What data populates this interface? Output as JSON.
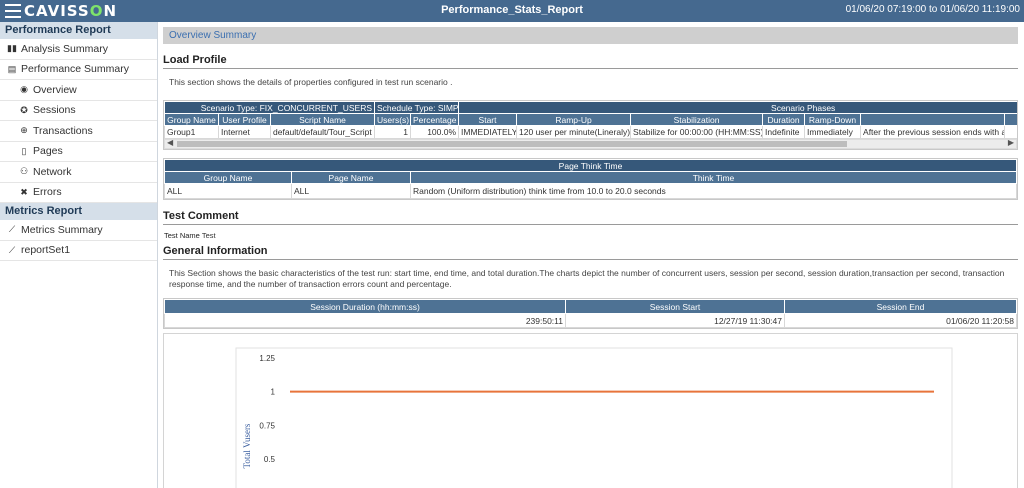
{
  "topbar": {
    "logo_pre": "CAVISS",
    "logo_o": "O",
    "logo_post": "N",
    "title": "Performance_Stats_Report",
    "range": "01/06/20 07:19:00 to 01/06/20 11:19:00"
  },
  "sidebar": {
    "performance_header": "Performance Report",
    "items": [
      {
        "label": "Analysis Summary",
        "icon": "bar-chart-icon"
      },
      {
        "label": "Performance Summary",
        "icon": "document-icon"
      },
      {
        "label": "Overview",
        "icon": "eye-icon"
      },
      {
        "label": "Sessions",
        "icon": "sessions-icon"
      },
      {
        "label": "Transactions",
        "icon": "transactions-icon"
      },
      {
        "label": "Pages",
        "icon": "page-icon"
      },
      {
        "label": "Network",
        "icon": "network-icon"
      },
      {
        "label": "Errors",
        "icon": "error-icon"
      }
    ],
    "metrics_header": "Metrics Report",
    "metrics_items": [
      {
        "label": "Metrics Summary",
        "icon": "line-chart-icon"
      },
      {
        "label": "reportSet1",
        "icon": "line-chart-icon"
      }
    ]
  },
  "main": {
    "tab": "Overview Summary",
    "load_profile": {
      "title": "Load Profile",
      "desc": "This section shows the details of properties configured in test run scenario .",
      "scenario_type": "Scenario Type: FIX_CONCURRENT_USERS",
      "schedule_type": "Schedule Type: SIMPLE",
      "phases_label": "Scenario Phases",
      "columns": [
        "Group Name",
        "User Profile",
        "Script Name",
        "Users(s)",
        "Percentage",
        "Start",
        "Ramp-Up",
        "Stabilization",
        "Duration",
        "Ramp-Down",
        "",
        "Se"
      ],
      "rows": [
        [
          "Group1",
          "Internet",
          "default/default/Tour_Script",
          "1",
          "100.0%",
          "IMMEDIATELY",
          "120 user per minute(Lineraly)",
          "Stabilize for 00:00:00 (HH:MM:SS)",
          "Indefinite",
          "Immediately",
          "After the previous session ends with a ran",
          ""
        ]
      ]
    },
    "think_time": {
      "title": "Page Think Time",
      "columns": [
        "Group Name",
        "Page Name",
        "Think Time"
      ],
      "rows": [
        [
          "ALL",
          "ALL",
          "Random (Uniform distribution) think time from 10.0 to 20.0 seconds"
        ]
      ]
    },
    "test_comment": {
      "title": "Test Comment",
      "label": "Test Name",
      "value": "Test"
    },
    "general": {
      "title": "General Information",
      "desc": "This Section shows the basic characteristics of the test run: start time, end time, and total duration.The charts depict the number of concurrent users, session per second, session duration,transaction per second, transaction response time, and the number of transaction errors count and percentage.",
      "columns": [
        "Session Duration (hh:mm:ss)",
        "Session Start",
        "Session End"
      ],
      "values": [
        "239:50:11",
        "12/27/19 11:30:47",
        "01/06/20 11:20:58"
      ]
    }
  },
  "chart_data": {
    "type": "line",
    "ylabel": "Total Vusers",
    "ylim": [
      0.5,
      1.25
    ],
    "yticks": [
      "1.25",
      "1",
      "0.75",
      "0.5"
    ],
    "series": [
      {
        "values": [
          1,
          1
        ]
      }
    ],
    "series_color": "#e8743b",
    "grid": false
  }
}
